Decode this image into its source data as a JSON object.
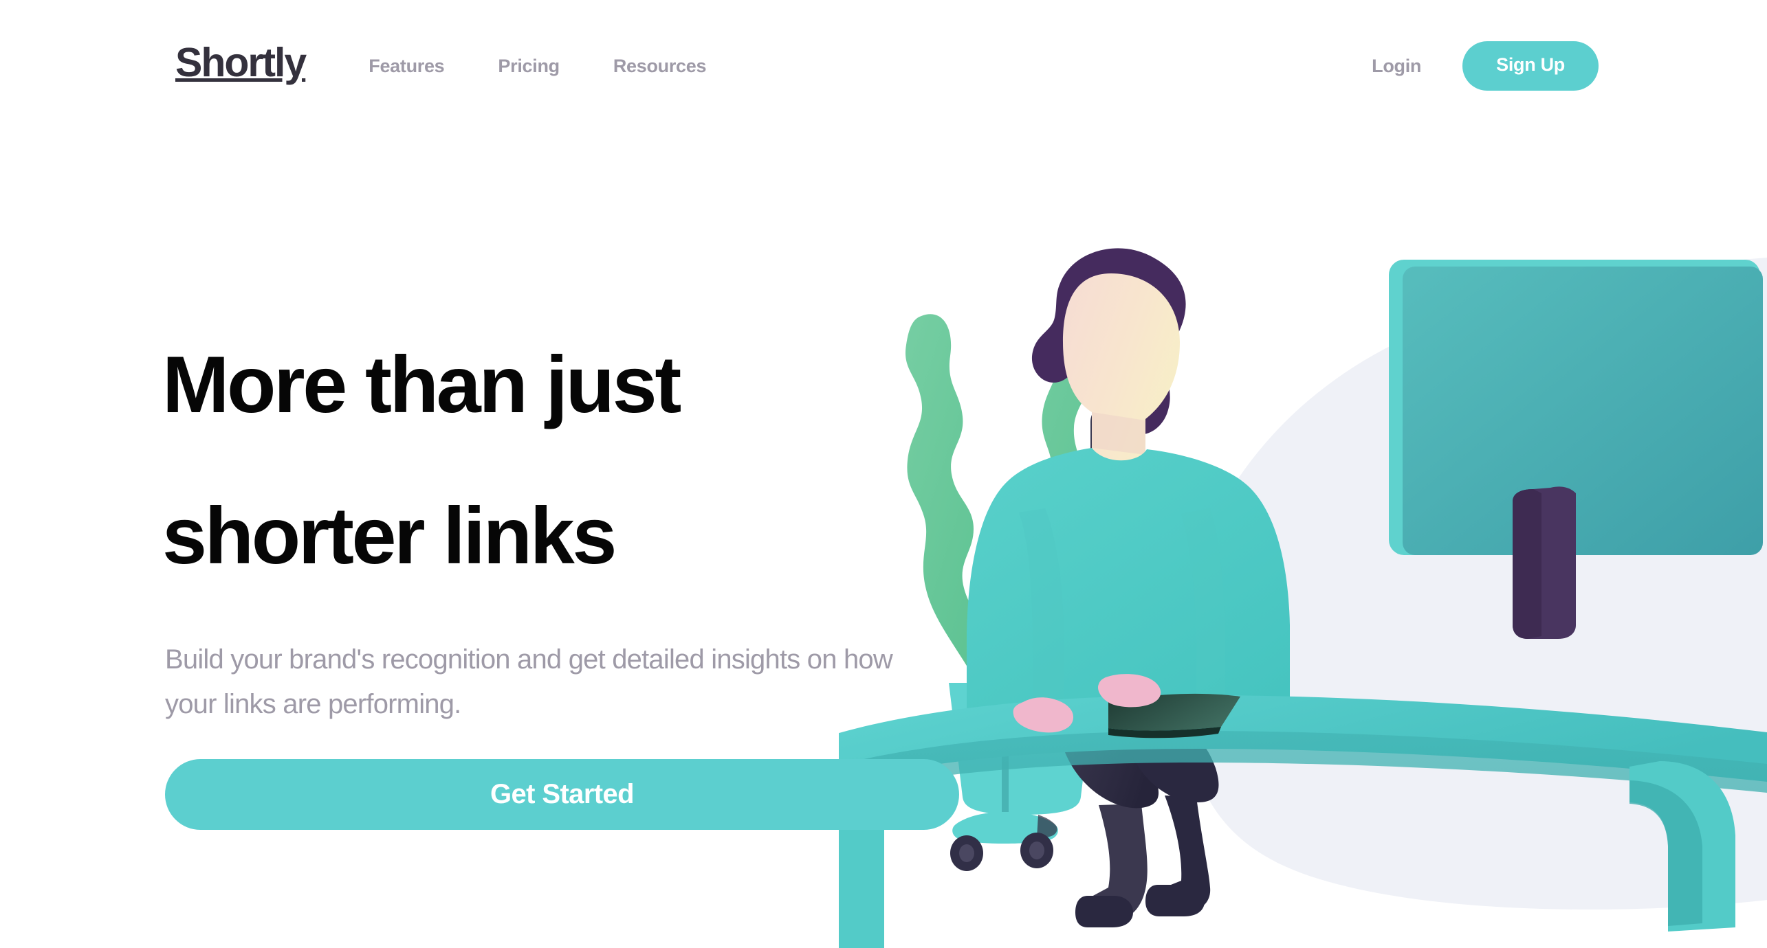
{
  "brand": {
    "logo_text": "Shortly",
    "logo_color": "#34313D"
  },
  "colors": {
    "accent_teal": "#5CCFCF",
    "muted_gray": "#9E9AA7",
    "heading_black": "#060606",
    "blob_gray": "#EFF1F7",
    "hair_purple": "#452B5E",
    "leg_navy": "#2F2E41",
    "plant_green": "#6FCBA2",
    "monitor_teal": "#4BB8B8",
    "skin_cream": "#F7E8D0"
  },
  "navbar": {
    "links": [
      {
        "label": "Features",
        "name": "nav-link-features"
      },
      {
        "label": "Pricing",
        "name": "nav-link-pricing"
      },
      {
        "label": "Resources",
        "name": "nav-link-resources"
      }
    ],
    "login_label": "Login",
    "signup_label": "Sign Up"
  },
  "hero": {
    "title_line1": "More than just",
    "title_line2": "shorter links",
    "subtitle": "Build your brand's recognition and get detailed insights on how your links are performing.",
    "cta_label": "Get Started"
  },
  "illustration": {
    "alt": "Person seated at a desk working on a computer with a potted plant beside them",
    "elements": [
      "background-blob",
      "potted-plant",
      "desk",
      "office-chair",
      "monitor",
      "keyboard",
      "person"
    ]
  }
}
